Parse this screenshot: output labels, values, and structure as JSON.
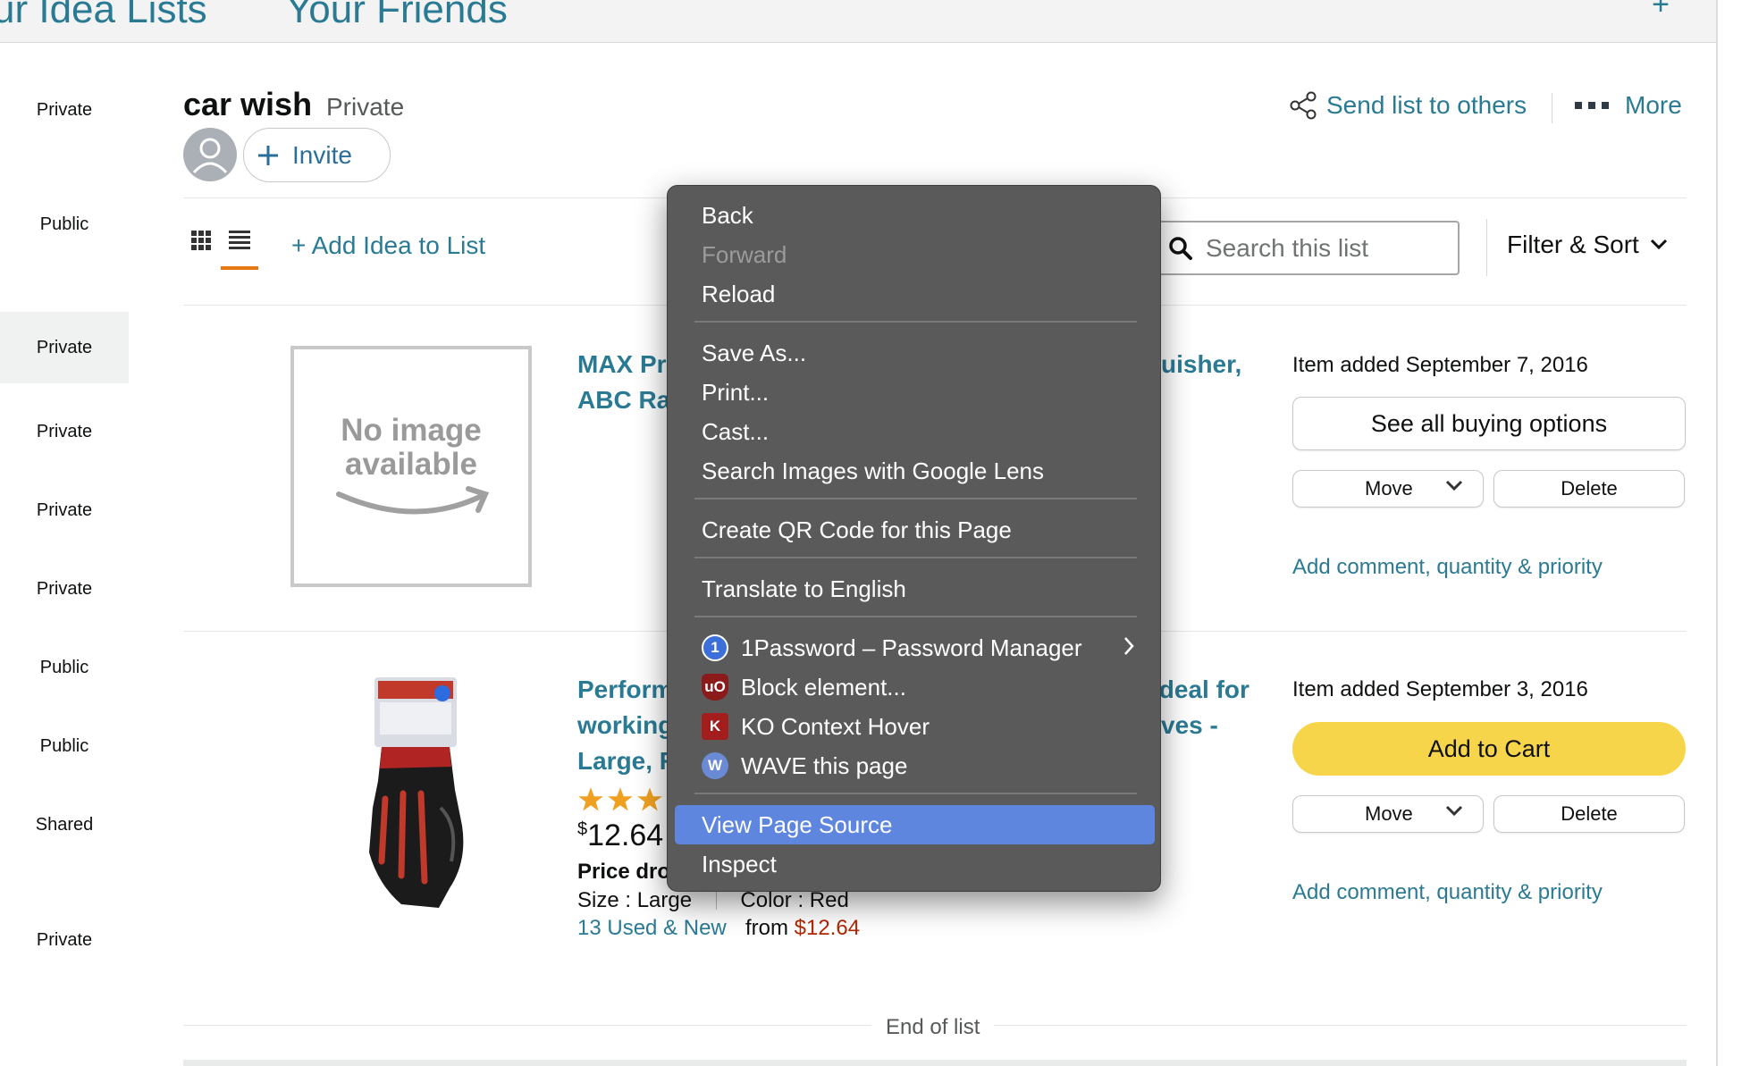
{
  "topbar": {
    "tab_idea_lists": "ur Idea Lists",
    "tab_friends": "Your Friends",
    "plus": "+"
  },
  "sidebar": {
    "items": [
      {
        "label": "Private"
      },
      {
        "label": "Public"
      },
      {
        "label": "Private"
      },
      {
        "label": "Private"
      },
      {
        "label": "Private"
      },
      {
        "label": "Private"
      },
      {
        "label": "Public"
      },
      {
        "label": "Public"
      },
      {
        "label": "Shared"
      },
      {
        "label": "Private"
      }
    ]
  },
  "list": {
    "title": "car wish",
    "privacy": "Private",
    "invite_label": "Invite",
    "send_list": "Send list to others",
    "more": "More",
    "add_idea": "+ Add Idea to List",
    "search_placeholder": "Search this list",
    "filter_sort": "Filter & Sort",
    "end_of_list": "End of list"
  },
  "items": [
    {
      "image_text": "No image available",
      "title_line1_left": "MAX Pr",
      "title_line1_right": "uisher,",
      "title_line2_left": "ABC Rat",
      "added": "Item added September 7, 2016",
      "primary_button": "See all buying options",
      "move": "Move",
      "delete": "Delete",
      "comment": "Add comment, quantity & priority"
    },
    {
      "title_line1_left": "Perform",
      "title_line1_right": "Ideal for",
      "title_line2_left": "working",
      "title_line2_right": "ves -",
      "title_line3_left": "Large, R",
      "rating": 3,
      "price_symbol": "$",
      "price_value": "12.64",
      "price_drop": "Price dro",
      "size": "Size : Large",
      "color": "Color : Red",
      "used_new": "13 Used & New",
      "from_label": "from",
      "from_price": "$12.64",
      "added": "Item added September 3, 2016",
      "primary_button": "Add to Cart",
      "move": "Move",
      "delete": "Delete",
      "comment": "Add comment, quantity & priority"
    }
  ],
  "context_menu": {
    "items": [
      {
        "label": "Back"
      },
      {
        "label": "Forward",
        "disabled": true
      },
      {
        "label": "Reload"
      },
      {
        "label": "Save As..."
      },
      {
        "label": "Print..."
      },
      {
        "label": "Cast..."
      },
      {
        "label": "Search Images with Google Lens"
      },
      {
        "label": "Create QR Code for this Page"
      },
      {
        "label": "Translate to English"
      },
      {
        "label": "1Password – Password Manager",
        "icon": "1password-icon",
        "submenu": true
      },
      {
        "label": "Block element...",
        "icon": "ublock-icon"
      },
      {
        "label": "KO Context Hover",
        "icon": "ko-icon"
      },
      {
        "label": "WAVE this page",
        "icon": "wave-icon"
      },
      {
        "label": "View Page Source",
        "selected": true
      },
      {
        "label": "Inspect"
      }
    ]
  },
  "colors": {
    "link": "#2a7a94",
    "cart_button": "#f7d54b",
    "menu_bg": "#5a5a5a",
    "menu_selected": "#5e86df",
    "price_red": "#b12704",
    "tab_underline": "#e47911"
  }
}
